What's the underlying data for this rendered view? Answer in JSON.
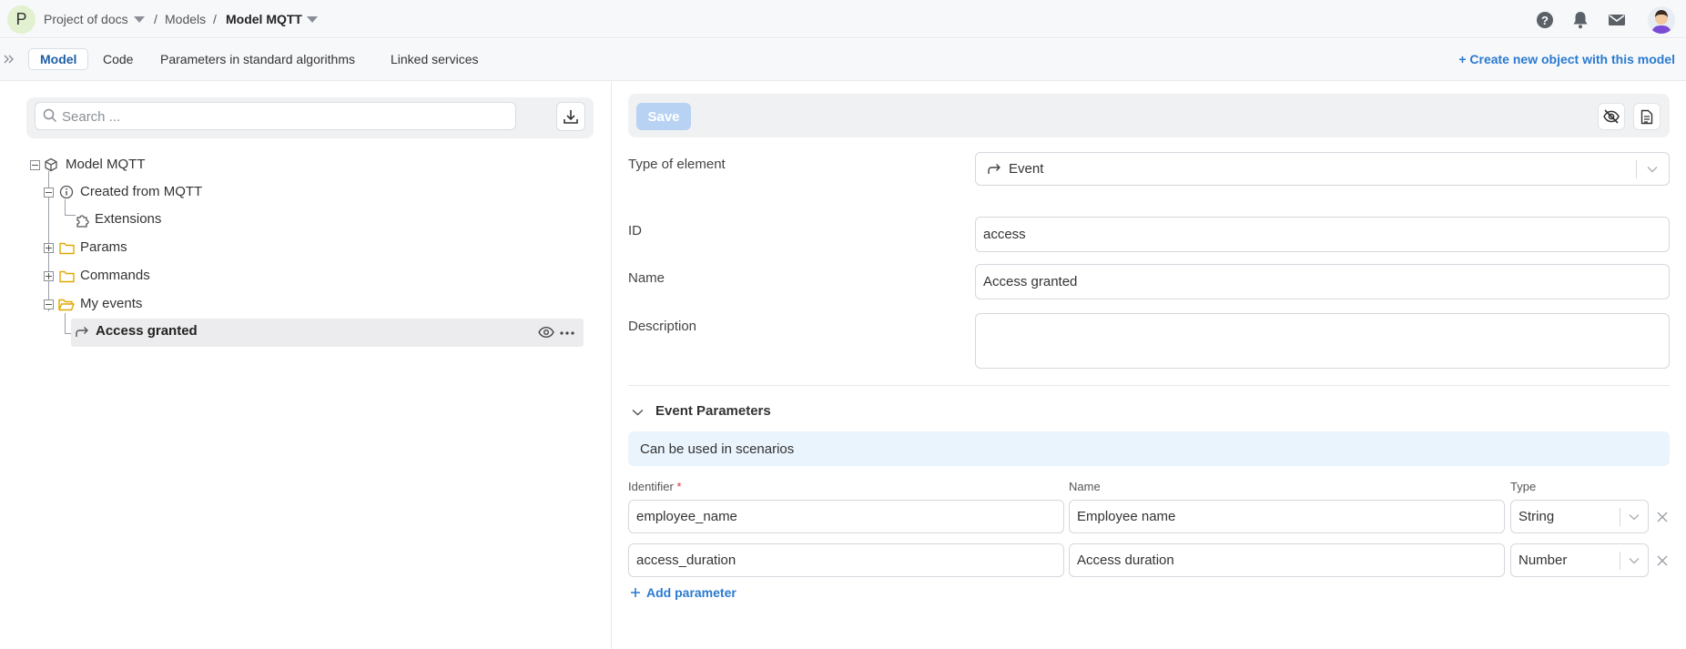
{
  "header": {
    "project_initial": "P",
    "breadcrumbs": [
      {
        "label": "Project of docs"
      },
      {
        "label": "/"
      },
      {
        "label": "Models"
      },
      {
        "label": "/"
      },
      {
        "label": "Model MQTT"
      }
    ]
  },
  "tabs": [
    {
      "label": "Model",
      "active": true
    },
    {
      "label": "Code",
      "active": false
    },
    {
      "label": "Parameters in standard algorithms",
      "active": false
    },
    {
      "label": "Linked services",
      "active": false
    }
  ],
  "create_link": "+ Create new object with this model",
  "search": {
    "placeholder": "Search ...",
    "value": ""
  },
  "tree": {
    "root": "Model MQTT",
    "created_from": "Created from MQTT",
    "extensions": "Extensions",
    "params": "Params",
    "commands": "Commands",
    "my_events": "My events",
    "access_granted": "Access granted"
  },
  "toolbar": {
    "save_label": "Save"
  },
  "form": {
    "type_label": "Type of element",
    "type_value": "Event",
    "id_label": "ID",
    "id_value": "access",
    "name_label": "Name",
    "name_value": "Access granted",
    "description_label": "Description",
    "description_value": ""
  },
  "event_params": {
    "title": "Event Parameters",
    "banner": "Can be used in scenarios",
    "headers": {
      "identifier": "Identifier",
      "required_mark": "*",
      "name": "Name",
      "type": "Type"
    },
    "rows": [
      {
        "identifier": "employee_name",
        "name": "Employee name",
        "type": "String"
      },
      {
        "identifier": "access_duration",
        "name": "Access duration",
        "type": "Number"
      }
    ],
    "add_label": "Add parameter"
  },
  "colors": {
    "accent": "#2a7ad0",
    "save_disabled": "#b8d2f3",
    "banner": "#eaf4fc",
    "folder": "#e0a800"
  }
}
